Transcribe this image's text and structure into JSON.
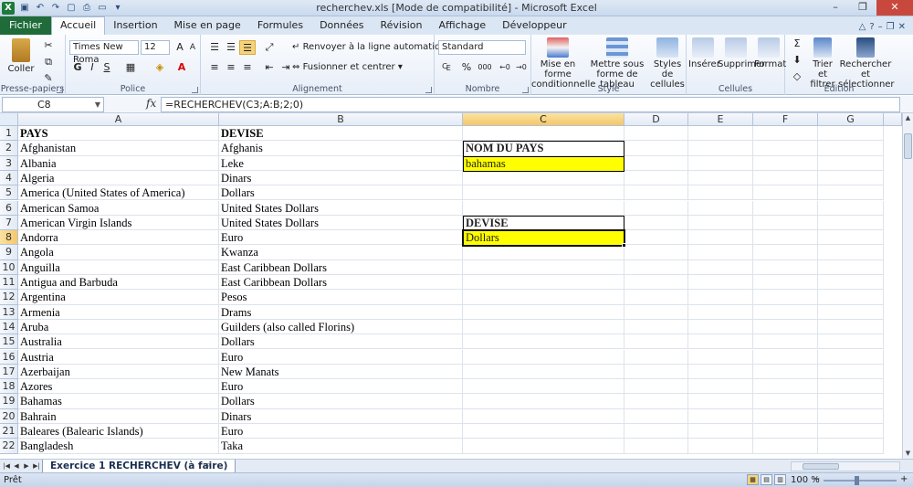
{
  "window": {
    "title": "recherchev.xls  [Mode de compatibilité]  -  Microsoft Excel",
    "app_icon": "X"
  },
  "tabs": [
    "Fichier",
    "Accueil",
    "Insertion",
    "Mise en page",
    "Formules",
    "Données",
    "Révision",
    "Affichage",
    "Développeur"
  ],
  "ribbon": {
    "clipboard": {
      "paste": "Coller",
      "label": "Presse-papiers"
    },
    "font": {
      "name": "Times New Roma",
      "size": "12",
      "bold": "G",
      "italic": "I",
      "underline": "S",
      "label": "Police"
    },
    "alignment": {
      "wrap": "Renvoyer à la ligne automatiquement",
      "merge": "Fusionner et centrer",
      "label": "Alignement"
    },
    "number": {
      "format": "Standard",
      "percent": "%",
      "thousands": "000",
      "label": "Nombre"
    },
    "styles": {
      "conditional": "Mise en forme conditionnelle",
      "as_table": "Mettre sous forme de tableau",
      "cell_styles": "Styles de cellules",
      "label": "Style"
    },
    "cells": {
      "insert": "Insérer",
      "delete": "Supprimer",
      "format": "Format",
      "label": "Cellules"
    },
    "editing": {
      "sort": "Trier et filtrer",
      "find": "Rechercher et sélectionner",
      "label": "Édition"
    }
  },
  "formula_bar": {
    "name_box": "C8",
    "fx": "fx",
    "formula": "=RECHERCHEV(C3;A:B;2;0)"
  },
  "columns": [
    "A",
    "B",
    "C",
    "D",
    "E",
    "F",
    "G"
  ],
  "rows": [
    {
      "n": "1",
      "a": "PAYS",
      "b": "DEVISE"
    },
    {
      "n": "2",
      "a": "Afghanistan",
      "b": "Afghanis"
    },
    {
      "n": "3",
      "a": "Albania",
      "b": "Leke"
    },
    {
      "n": "4",
      "a": "Algeria",
      "b": "Dinars"
    },
    {
      "n": "5",
      "a": "America (United States of America)",
      "b": "Dollars"
    },
    {
      "n": "6",
      "a": "American Samoa",
      "b": "United States Dollars"
    },
    {
      "n": "7",
      "a": "American Virgin Islands",
      "b": "United States Dollars"
    },
    {
      "n": "8",
      "a": "Andorra",
      "b": "Euro"
    },
    {
      "n": "9",
      "a": "Angola",
      "b": "Kwanza"
    },
    {
      "n": "10",
      "a": "Anguilla",
      "b": "East Caribbean Dollars"
    },
    {
      "n": "11",
      "a": "Antigua and Barbuda",
      "b": "East Caribbean Dollars"
    },
    {
      "n": "12",
      "a": "Argentina",
      "b": "Pesos"
    },
    {
      "n": "13",
      "a": "Armenia",
      "b": "Drams"
    },
    {
      "n": "14",
      "a": "Aruba",
      "b": "Guilders (also called Florins)"
    },
    {
      "n": "15",
      "a": "Australia",
      "b": "Dollars"
    },
    {
      "n": "16",
      "a": "Austria",
      "b": "Euro"
    },
    {
      "n": "17",
      "a": "Azerbaijan",
      "b": "New Manats"
    },
    {
      "n": "18",
      "a": "Azores",
      "b": "Euro"
    },
    {
      "n": "19",
      "a": "Bahamas",
      "b": "Dollars"
    },
    {
      "n": "20",
      "a": "Bahrain",
      "b": "Dinars"
    },
    {
      "n": "21",
      "a": "Baleares (Balearic Islands)",
      "b": "Euro"
    },
    {
      "n": "22",
      "a": "Bangladesh",
      "b": "Taka"
    }
  ],
  "lookup": {
    "country_header": "NOM DU PAYS",
    "country_value": "bahamas",
    "currency_header": "DEVISE",
    "currency_value": "Dollars"
  },
  "sheet_tab": "Exercice 1 RECHERCHEV (à faire)",
  "status": {
    "ready": "Prêt",
    "zoom": "100 %"
  },
  "colors": {
    "highlight": "#ffff00",
    "file_tab": "#1f6b3a",
    "selected_header": "#f4c76a"
  }
}
